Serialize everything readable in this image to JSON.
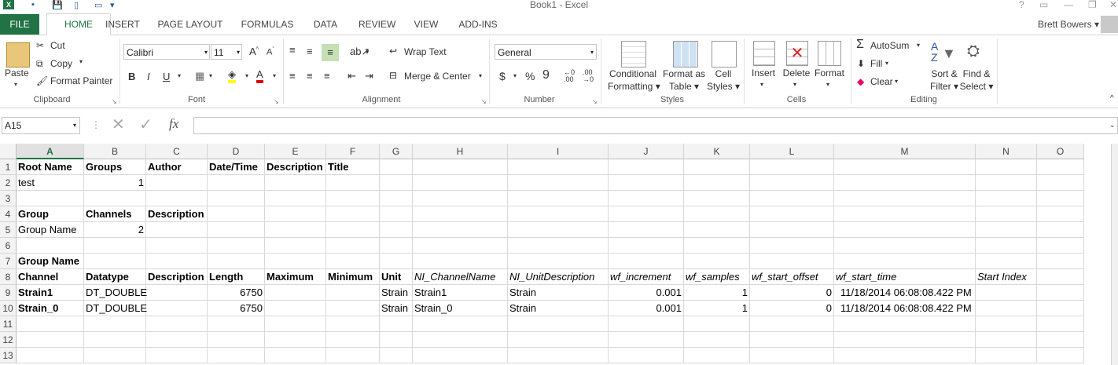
{
  "window": {
    "title": "Book1 - Excel",
    "help": "?",
    "ribbon_display": "▭",
    "minimize": "—",
    "restore": "❐",
    "close": "✕",
    "user": "Brett Bowers"
  },
  "tabs": [
    "FILE",
    "HOME",
    "INSERT",
    "PAGE LAYOUT",
    "FORMULAS",
    "DATA",
    "REVIEW",
    "VIEW",
    "ADD-INS"
  ],
  "clipboard": {
    "paste": "Paste",
    "cut": "Cut",
    "copy": "Copy",
    "format_painter": "Format Painter",
    "group": "Clipboard"
  },
  "font": {
    "name": "Calibri",
    "size": "11",
    "bold": "B",
    "italic": "I",
    "underline": "U",
    "group": "Font"
  },
  "alignment": {
    "wrap": "Wrap Text",
    "merge": "Merge & Center",
    "group": "Alignment"
  },
  "number": {
    "format": "General",
    "currency": "$",
    "percent": "%",
    "comma": "9",
    "inc_decimal": ".00",
    "dec_decimal": "",
    "group": "Number"
  },
  "styles": {
    "conditional": [
      "Conditional",
      "Formatting"
    ],
    "format_table": [
      "Format as",
      "Table"
    ],
    "cell_styles": [
      "Cell",
      "Styles"
    ],
    "group": "Styles"
  },
  "cells": {
    "insert": "Insert",
    "delete": "Delete",
    "format": "Format",
    "group": "Cells"
  },
  "editing": {
    "autosum": "AutoSum",
    "fill": "Fill",
    "clear": "Clear",
    "sort": [
      "Sort &",
      "Filter"
    ],
    "find": [
      "Find &",
      "Select"
    ],
    "group": "Editing"
  },
  "formula_bar": {
    "name_box": "A15",
    "fx": "fx",
    "value": ""
  },
  "columns": [
    "A",
    "B",
    "C",
    "D",
    "E",
    "F",
    "G",
    "H",
    "I",
    "J",
    "K",
    "L",
    "M",
    "N",
    "O"
  ],
  "rows": [
    "1",
    "2",
    "3",
    "4",
    "5",
    "6",
    "7",
    "8",
    "9",
    "10",
    "11",
    "12",
    "13"
  ],
  "cells_data": {
    "r1": [
      "Root Name",
      "Groups",
      "Author",
      "Date/Time",
      "Description",
      "Title",
      "",
      "",
      "",
      "",
      "",
      "",
      "",
      "",
      ""
    ],
    "r2": [
      "test",
      "1",
      "",
      "",
      "",
      "",
      "",
      "",
      "",
      "",
      "",
      "",
      "",
      "",
      ""
    ],
    "r3": [
      "",
      "",
      "",
      "",
      "",
      "",
      "",
      "",
      "",
      "",
      "",
      "",
      "",
      "",
      ""
    ],
    "r4": [
      "Group",
      "Channels",
      "Description",
      "",
      "",
      "",
      "",
      "",
      "",
      "",
      "",
      "",
      "",
      "",
      ""
    ],
    "r5": [
      "Group Name",
      "2",
      "",
      "",
      "",
      "",
      "",
      "",
      "",
      "",
      "",
      "",
      "",
      "",
      ""
    ],
    "r6": [
      "",
      "",
      "",
      "",
      "",
      "",
      "",
      "",
      "",
      "",
      "",
      "",
      "",
      "",
      ""
    ],
    "r7": [
      "Group Name",
      "",
      "",
      "",
      "",
      "",
      "",
      "",
      "",
      "",
      "",
      "",
      "",
      "",
      ""
    ],
    "r8": [
      "Channel",
      "Datatype",
      "Description",
      "Length",
      "Maximum",
      "Minimum",
      "Unit",
      "NI_ChannelName",
      "NI_UnitDescription",
      "wf_increment",
      "wf_samples",
      "wf_start_offset",
      "wf_start_time",
      "Start Index",
      ""
    ],
    "r9": [
      "Strain1",
      "DT_DOUBLE",
      "",
      "6750",
      "",
      "",
      "Strain",
      "Strain1",
      "Strain",
      "0.001",
      "1",
      "0",
      "11/18/2014 06:08:08.422 PM",
      "",
      ""
    ],
    "r10": [
      "Strain_0",
      "DT_DOUBLE",
      "",
      "6750",
      "",
      "",
      "Strain",
      "Strain_0",
      "Strain",
      "0.001",
      "1",
      "0",
      "11/18/2014 06:08:08.422 PM",
      "",
      ""
    ],
    "r11": [
      "",
      "",
      "",
      "",
      "",
      "",
      "",
      "",
      "",
      "",
      "",
      "",
      "",
      "",
      ""
    ],
    "r12": [
      "",
      "",
      "",
      "",
      "",
      "",
      "",
      "",
      "",
      "",
      "",
      "",
      "",
      "",
      ""
    ],
    "r13": [
      "",
      "",
      "",
      "",
      "",
      "",
      "",
      "",
      "",
      "",
      "",
      "",
      "",
      "",
      ""
    ]
  },
  "colors": {
    "accent": "#217346",
    "grid_line": "#d9d9d9",
    "header_bg": "#f3f3f3"
  }
}
